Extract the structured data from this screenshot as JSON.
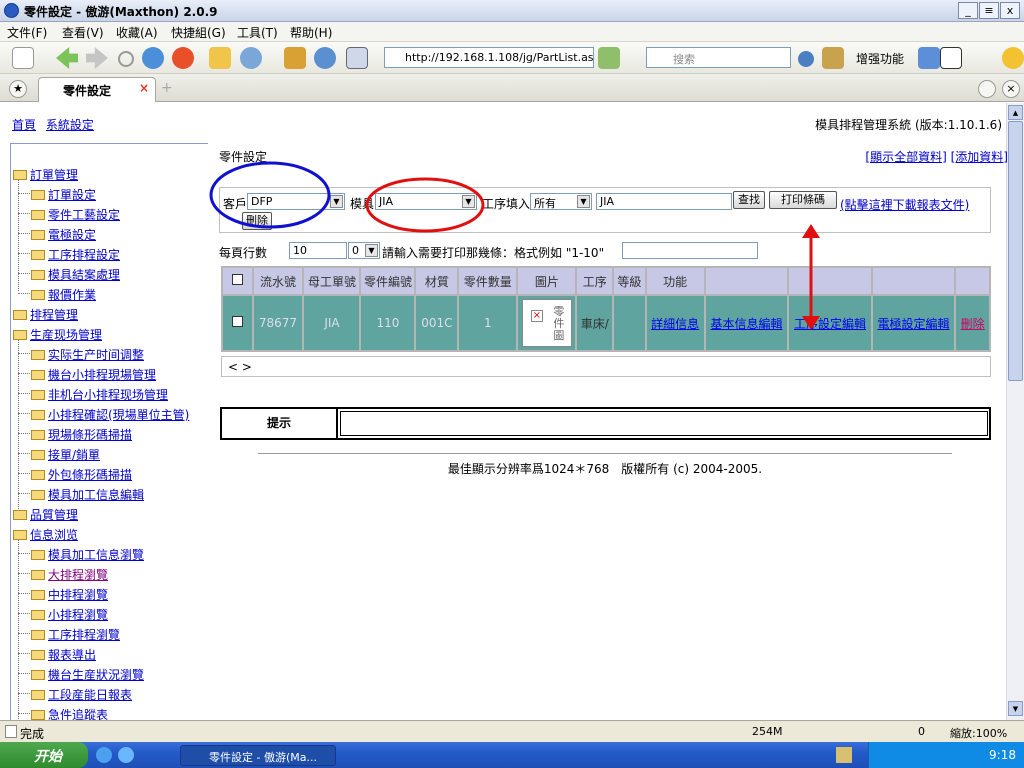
{
  "window": {
    "title": "零件設定 - 傲游(Maxthon) 2.0.9",
    "min": "_",
    "max": "≡",
    "close": "x"
  },
  "menu": [
    "文件(F)",
    "查看(V)",
    "收藏(A)",
    "快捷組(G)",
    "工具(T)",
    "帮助(H)"
  ],
  "toolbar": {
    "address": "http://192.168.1.108/jg/PartList.as",
    "search_placeholder": "搜索",
    "enhance": "增强功能"
  },
  "tab": {
    "label": "零件設定",
    "close": "×"
  },
  "topnav": {
    "home": "首頁",
    "sys": "系統設定",
    "version": "模具排程管理系統 (版本:1.10.1.6)"
  },
  "sidebar": [
    {
      "label": "訂單管理",
      "level": 0
    },
    {
      "label": "訂單設定",
      "level": 1
    },
    {
      "label": "零件工藝設定",
      "level": 1
    },
    {
      "label": "電極設定",
      "level": 1
    },
    {
      "label": "工序排程設定",
      "level": 1
    },
    {
      "label": "模具結案處理",
      "level": 1
    },
    {
      "label": "報價作業",
      "level": 1
    },
    {
      "label": "排程管理",
      "level": 0
    },
    {
      "label": "生産现场管理",
      "level": 0
    },
    {
      "label": "实际生产时间调整",
      "level": 1
    },
    {
      "label": "機台小排程現場管理",
      "level": 1
    },
    {
      "label": "非机台小排程现场管理",
      "level": 1
    },
    {
      "label": "小排程確認(現場單位主管)",
      "level": 1
    },
    {
      "label": "現場條形碼掃描",
      "level": 1
    },
    {
      "label": "接單/銷單",
      "level": 1
    },
    {
      "label": "外包條形碼掃描",
      "level": 1
    },
    {
      "label": "模具加工信息編輯",
      "level": 1
    },
    {
      "label": "品質管理",
      "level": 0
    },
    {
      "label": "信息浏览",
      "level": 0
    },
    {
      "label": "模具加工信息瀏覽",
      "level": 1
    },
    {
      "label": "大排程瀏覽",
      "level": 1
    },
    {
      "label": "中排程瀏覽",
      "level": 1
    },
    {
      "label": "小排程瀏覽",
      "level": 1
    },
    {
      "label": "工序排程瀏覽",
      "level": 1
    },
    {
      "label": "報表導出",
      "level": 1
    },
    {
      "label": "機台生産狀況瀏覽",
      "level": 1
    },
    {
      "label": "工段産能日報表",
      "level": 1
    },
    {
      "label": "急件追蹤表",
      "level": 1
    }
  ],
  "header": {
    "title": "零件設定",
    "show_all": "[顯示全部資料]",
    "add": "[添加資料]"
  },
  "filter": {
    "customer_label": "客戶",
    "customer_value": "DFP",
    "mold_label": "模具",
    "mold_value": "JIA",
    "process_label": "工序填入",
    "process_value": "所有",
    "keyword": "JIA",
    "search_btn": "查找",
    "print_btn": "打印條碼",
    "download_link": "(點擊這裡下載報表文件)",
    "delete_btn": "刪除"
  },
  "paging": {
    "rows_label": "每頁行數",
    "rows_value": "10",
    "page_select": "0",
    "print_prompt": "請輸入需要打印那幾條：格式例如 \"1-10\"",
    "print_range": ""
  },
  "table": {
    "headers": [
      "",
      "流水號",
      "母工單號",
      "零件編號",
      "材質",
      "零件數量",
      "圖片",
      "工序",
      "等級",
      "功能",
      "",
      "",
      "",
      ""
    ],
    "row": {
      "serial": "78677",
      "order": "JIA",
      "part": "110",
      "material": "001C",
      "qty": "1",
      "image_alt": "零件圖",
      "process": "車床/",
      "grade": "",
      "actions": [
        "詳細信息",
        "基本信息編輯",
        "工序設定編輯",
        "電極設定編輯",
        "刪除"
      ]
    }
  },
  "pager": "< >",
  "hint": {
    "label": "提示",
    "text": ""
  },
  "footer": "最佳顯示分辨率爲1024＊768　版權所有 (c) 2004-2005.",
  "status": {
    "text": "完成",
    "memory": "254M",
    "zoom": "縮放:100%",
    "count": "0"
  },
  "taskbar": {
    "start": "开始",
    "item": "零件設定 - 傲游(Ma...",
    "clock": "9:18"
  },
  "colors": {
    "blue_circle": "#1010d0",
    "red_circle": "#e01010",
    "red_arrow": "#e01010",
    "row_bg": "#5fa49e",
    "header_bg": "#c7c7e6"
  }
}
